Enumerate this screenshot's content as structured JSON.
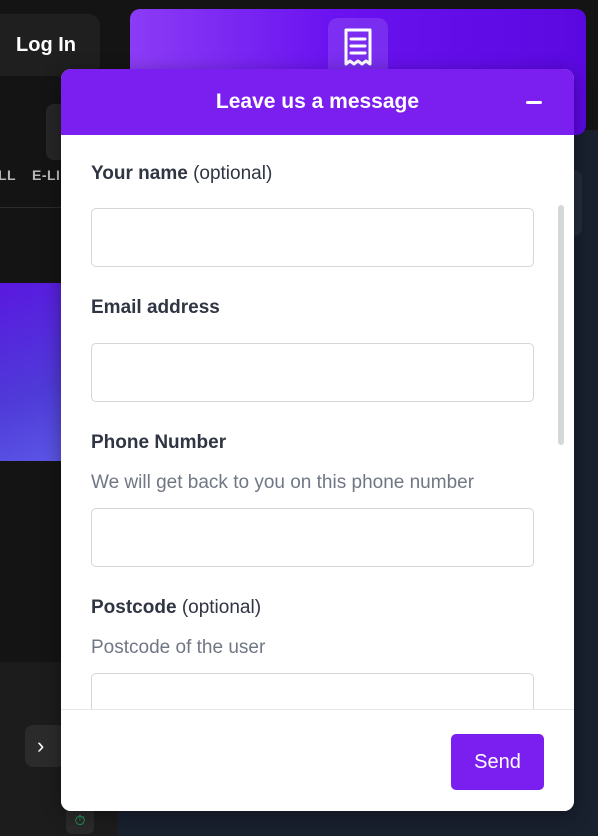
{
  "background": {
    "login_label": "Log In",
    "nav_items": [
      "LL",
      "E-LI"
    ],
    "next_arrow": "›",
    "timer_glyph": "⏱"
  },
  "widget": {
    "header_icon": "receipt-icon",
    "title": "Leave us a message",
    "accent_color": "#7b1ff0",
    "fields": [
      {
        "label": "Your name",
        "optional": "(optional)",
        "help": "",
        "value": ""
      },
      {
        "label": "Email address",
        "optional": "",
        "help": "",
        "value": ""
      },
      {
        "label": "Phone Number",
        "optional": "",
        "help": "We will get back to you on this phone number",
        "value": ""
      },
      {
        "label": "Postcode",
        "optional": "(optional)",
        "help": "Postcode of the user",
        "value": ""
      }
    ],
    "send_label": "Send"
  }
}
